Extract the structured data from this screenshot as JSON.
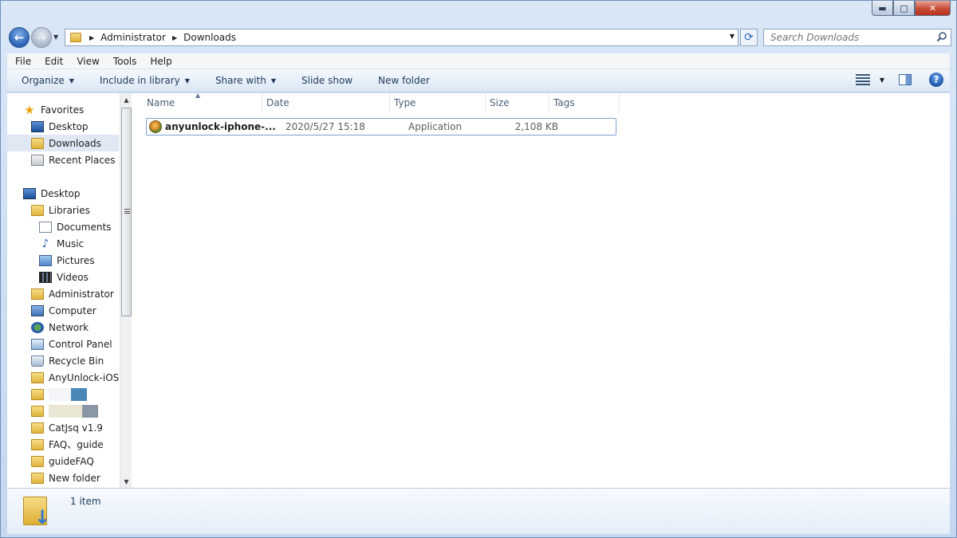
{
  "window": {
    "controls": {
      "minimize": "▬",
      "maximize": "□",
      "close": "✕"
    }
  },
  "address": {
    "breadcrumbs": [
      "Administrator",
      "Downloads"
    ],
    "search_placeholder": "Search Downloads"
  },
  "menubar": {
    "items": [
      "File",
      "Edit",
      "View",
      "Tools",
      "Help"
    ]
  },
  "commandbar": {
    "items": [
      "Organize",
      "Include in library",
      "Share with",
      "Slide show",
      "New folder"
    ]
  },
  "nav": {
    "favorites": {
      "label": "Favorites",
      "items": [
        {
          "label": "Desktop",
          "icon": "desktop-icon"
        },
        {
          "label": "Downloads",
          "icon": "downloads-folder-icon"
        },
        {
          "label": "Recent Places",
          "icon": "recent-places-icon"
        }
      ]
    },
    "tree": [
      {
        "label": "Desktop",
        "icon": "desktop-icon"
      },
      {
        "label": "Libraries",
        "icon": "libraries-icon"
      },
      {
        "label": "Documents",
        "icon": "documents-icon"
      },
      {
        "label": "Music",
        "icon": "music-icon"
      },
      {
        "label": "Pictures",
        "icon": "pictures-icon"
      },
      {
        "label": "Videos",
        "icon": "videos-icon"
      },
      {
        "label": "Administrator",
        "icon": "user-folder-icon"
      },
      {
        "label": "Computer",
        "icon": "computer-icon"
      },
      {
        "label": "Network",
        "icon": "network-icon"
      },
      {
        "label": "Control Panel",
        "icon": "control-panel-icon"
      },
      {
        "label": "Recycle Bin",
        "icon": "recycle-bin-icon"
      },
      {
        "label": "AnyUnlock-iOS P",
        "icon": "folder-icon"
      },
      {
        "label": "",
        "icon": "folder-icon"
      },
      {
        "label": "",
        "icon": "folder-icon"
      },
      {
        "label": "CatJsq v1.9",
        "icon": "folder-icon"
      },
      {
        "label": "FAQ、guide",
        "icon": "folder-icon"
      },
      {
        "label": "guideFAQ",
        "icon": "folder-icon"
      },
      {
        "label": "New folder",
        "icon": "folder-icon"
      }
    ]
  },
  "columns": [
    "Name",
    "Date",
    "Type",
    "Size",
    "Tags"
  ],
  "files": [
    {
      "name": "anyunlock-iphone-...",
      "date": "2020/5/27 15:18",
      "type": "Application",
      "size": "2,108 KB",
      "tags": ""
    }
  ],
  "details": {
    "item_count": "1 item"
  }
}
